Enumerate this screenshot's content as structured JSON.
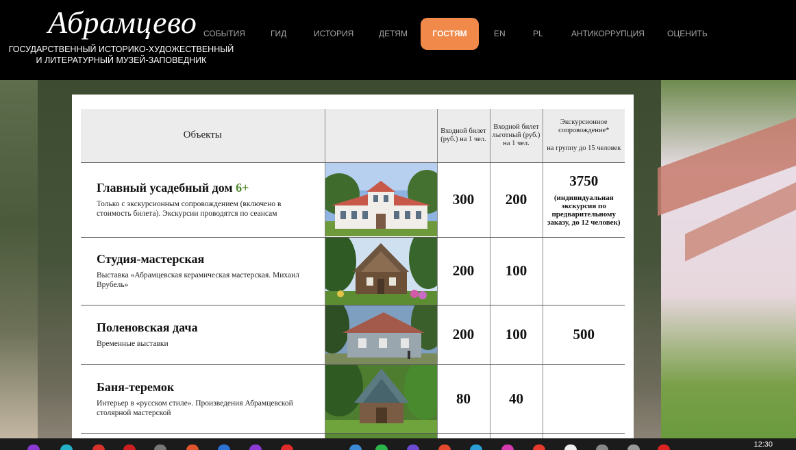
{
  "header": {
    "logo": "Абрамцево",
    "subtitle_line1": "ГОСУДАРСТВЕННЫЙ ИСТОРИКО-ХУДОЖЕСТВЕННЫЙ",
    "subtitle_line2": "И ЛИТЕРАТУРНЫЙ МУЗЕЙ-ЗАПОВЕДНИК",
    "nav": [
      {
        "label": "СОБЫТИЯ",
        "active": false
      },
      {
        "label": "ГИД",
        "active": false
      },
      {
        "label": "ИСТОРИЯ",
        "active": false
      },
      {
        "label": "ДЕТЯМ",
        "active": false
      },
      {
        "label": "ГОСТЯМ",
        "active": true
      },
      {
        "label": "EN",
        "active": false
      },
      {
        "label": "PL",
        "active": false
      },
      {
        "label": "АНТИКОРРУПЦИЯ",
        "active": false
      },
      {
        "label": "ОЦЕНИТЬ",
        "active": false
      }
    ],
    "accent_color": "#f0894a"
  },
  "table": {
    "headers": {
      "objects": "Объекты",
      "ticket_full": "Входной билет (руб.) на 1 чел.",
      "ticket_reduced": "Входной билет льготный (руб.) на 1 чел.",
      "tour_line1": "Экскурсионное сопровождение*",
      "tour_line2": "на группу до 15 человек"
    },
    "rows": [
      {
        "title": "Главный усадебный дом",
        "age": "6+",
        "desc": "Только с экскурсионным сопровождением (включено в стоимость билета). Экскурсии проводятся по сеансам",
        "full": "300",
        "reduced": "200",
        "tour": "3750",
        "tour_note": "(индивидуальная экскурсия по предварительному заказу, до 12 человек)",
        "photo": "manor-house-photo"
      },
      {
        "title": "Студия-мастерская",
        "age": "",
        "desc": "Выставка «Абрамцевская керамическая мастерская. Михаил Врубель»",
        "full": "200",
        "reduced": "100",
        "tour": "",
        "tour_note": "",
        "photo": "studio-photo"
      },
      {
        "title": "Поленовская дача",
        "age": "",
        "desc": "Временные выставки",
        "full": "200",
        "reduced": "100",
        "tour": "500",
        "tour_note": "",
        "photo": "dacha-photo"
      },
      {
        "title": "Баня-теремок",
        "age": "",
        "desc": "Интерьер в «русском стиле». Произведения Абрамцевской столярной мастерской",
        "full": "80",
        "reduced": "40",
        "tour": "",
        "tour_note": "",
        "photo": "bathhouse-photo"
      }
    ]
  },
  "taskbar": {
    "clock": "12:30"
  }
}
